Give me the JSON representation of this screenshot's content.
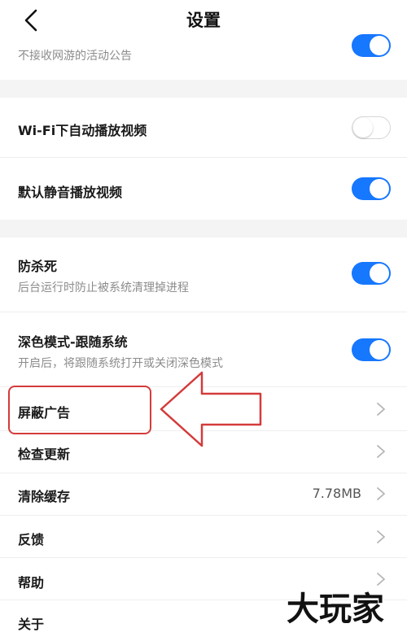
{
  "header": {
    "title": "设置",
    "back_icon": "chevron-left-icon"
  },
  "settings": {
    "activity_notice": {
      "subtitle": "不接收网游的活动公告",
      "enabled": true
    },
    "wifi_autoplay": {
      "label": "Wi-Fi下自动播放视频",
      "enabled": false
    },
    "mute_autoplay": {
      "label": "默认静音播放视频",
      "enabled": true
    },
    "anti_kill": {
      "label": "防杀死",
      "subtitle": "后台运行时防止被系统清理掉进程",
      "enabled": true
    },
    "dark_mode": {
      "label": "深色模式-跟随系统",
      "subtitle": "开启后，将跟随系统打开或关闭深色模式",
      "enabled": true
    },
    "block_ads": {
      "label": "屏蔽广告"
    },
    "check_update": {
      "label": "检查更新"
    },
    "clear_cache": {
      "label": "清除缓存",
      "value": "7.78MB"
    },
    "feedback": {
      "label": "反馈"
    },
    "help": {
      "label": "帮助"
    },
    "about": {
      "label": "关于"
    }
  },
  "watermark": {
    "text": "大玩家"
  },
  "colors": {
    "accent": "#1677ff",
    "highlight": "#d43b3b",
    "section_gap": "#f4f4f4",
    "subtitle": "#8c8c8c",
    "chevron": "#b5b5b5"
  }
}
